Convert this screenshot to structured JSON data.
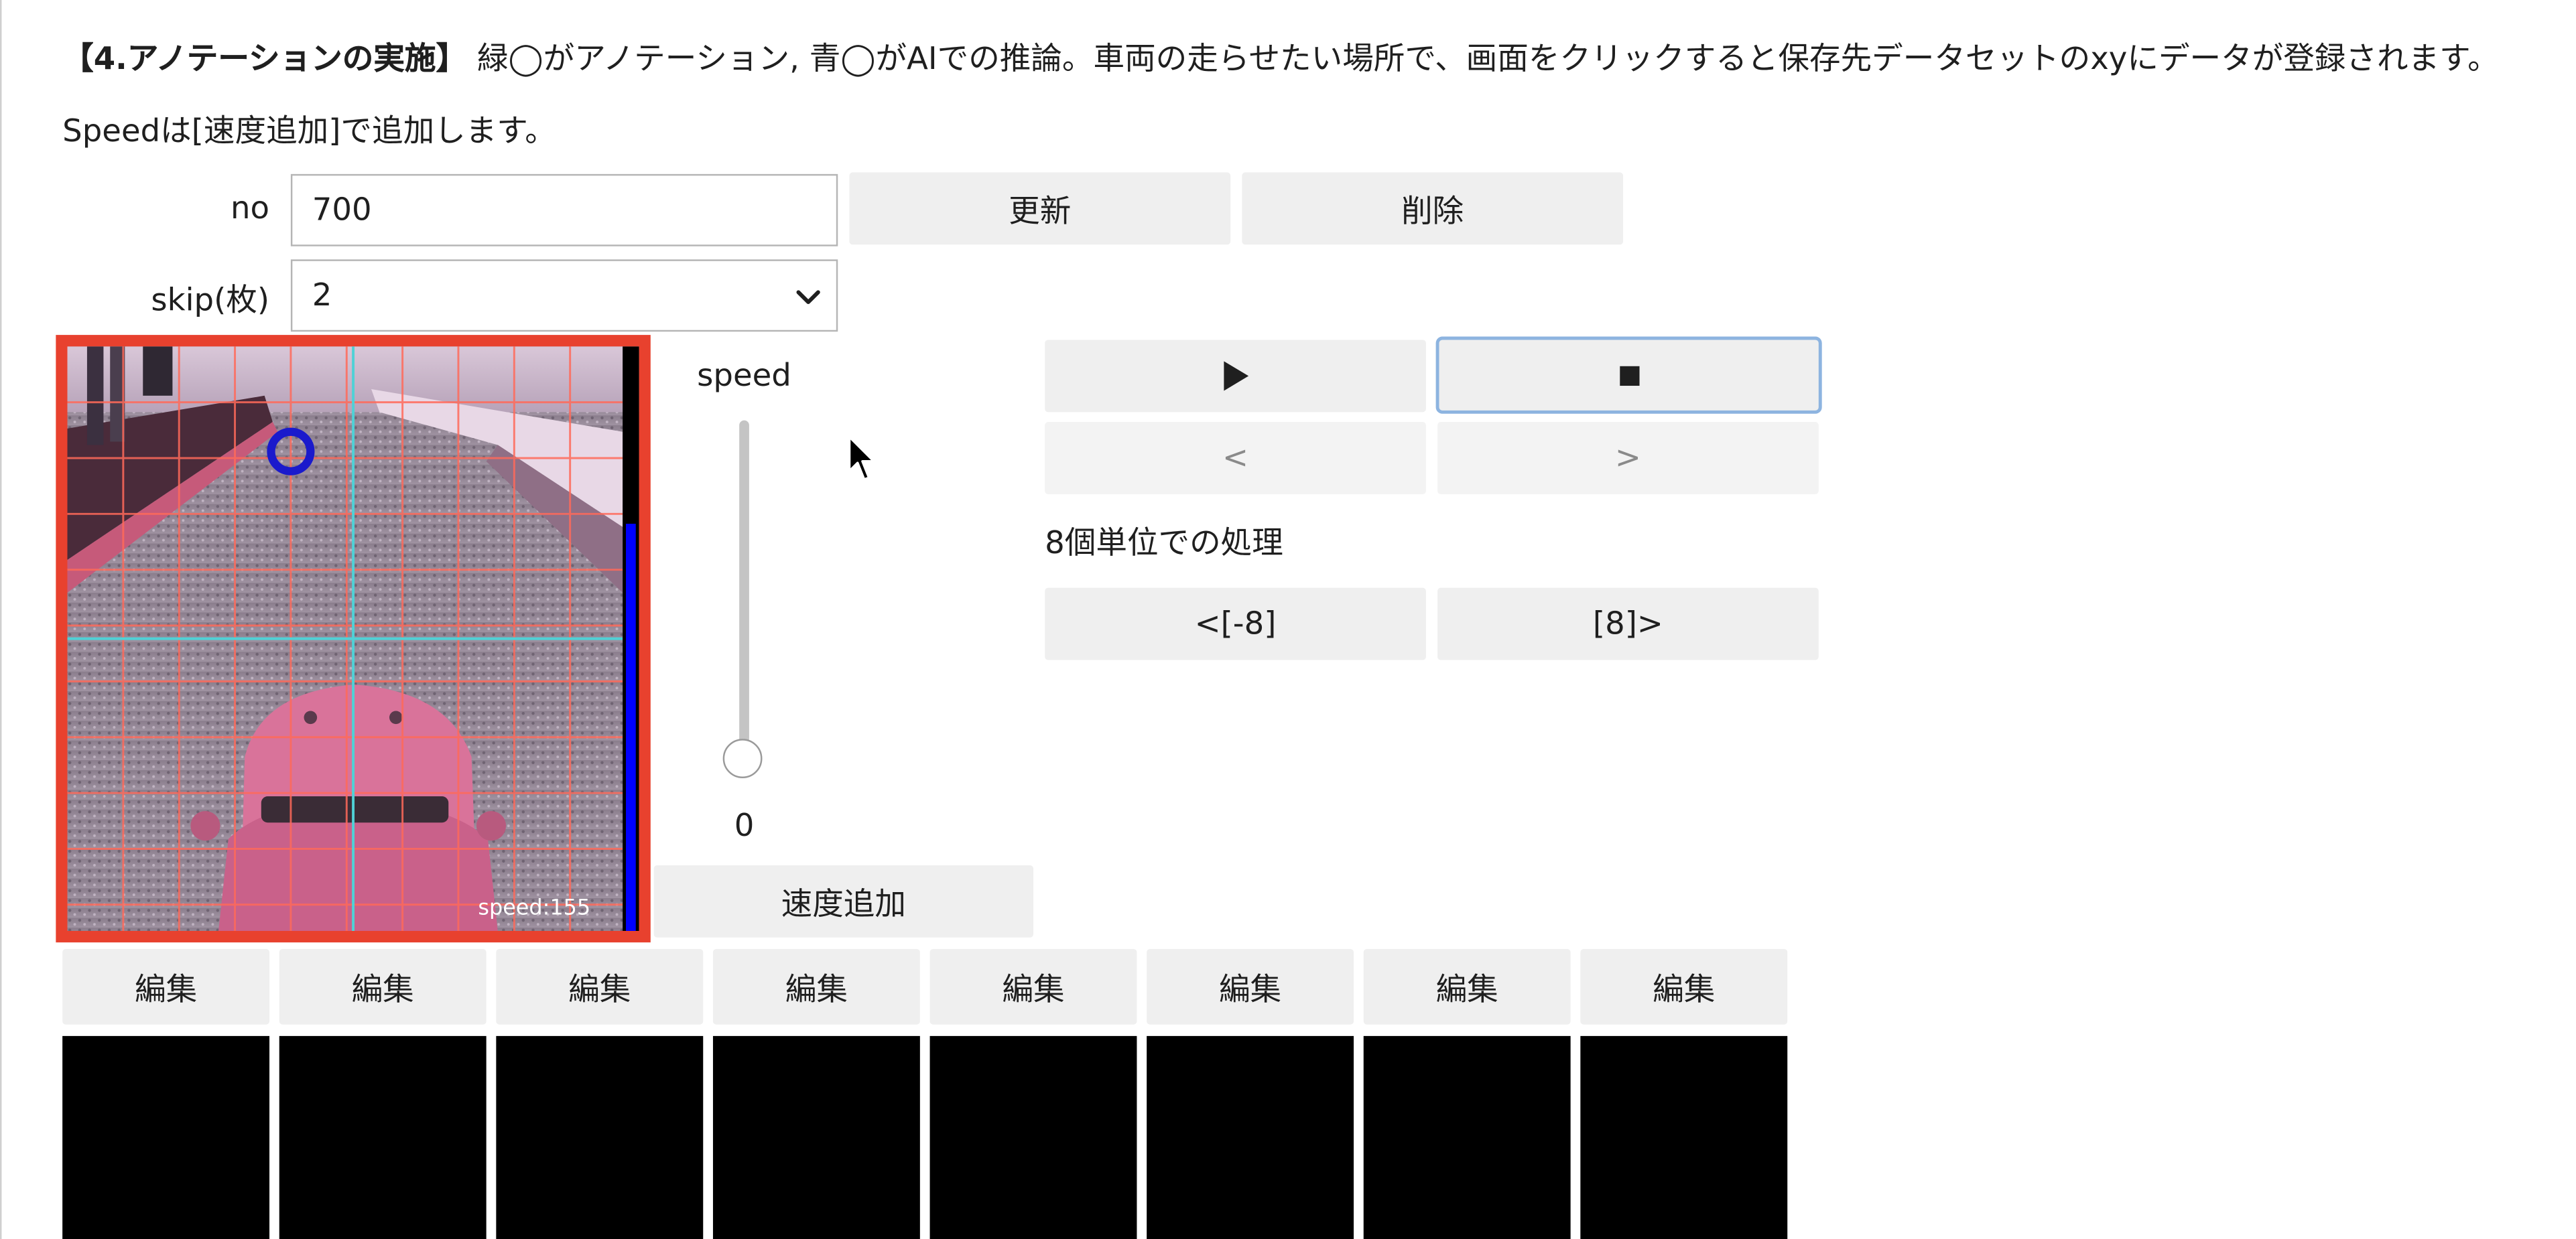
{
  "instructions": {
    "heading": "【4.アノテーションの実施】",
    "body": " 緑◯がアノテーション, 青◯がAIでの推論。車両の走らせたい場所で、画面をクリックすると保存先データセットのxyにデータが登録されます。Speedは[速度追加]で追加します。"
  },
  "form": {
    "no_label": "no",
    "no_value": "700",
    "skip_label": "skip(枚)",
    "skip_value": "2"
  },
  "buttons": {
    "update": "更新",
    "delete": "削除",
    "play": "▶",
    "stop": "■",
    "prev": "<",
    "next": ">",
    "prev8": "<[-8]",
    "next8": "[8]>",
    "add_speed": "速度追加"
  },
  "speed": {
    "label": "speed",
    "value": "0",
    "level": 0
  },
  "batch_label": "8個単位での処理",
  "camera": {
    "overlay_text": "speed:155"
  },
  "edit_buttons": [
    "編集",
    "編集",
    "編集",
    "編集",
    "編集",
    "編集",
    "編集",
    "編集"
  ],
  "colors": {
    "frame_border": "#e8412e",
    "grid": "#ff6a5a",
    "crosshair": "#4fd1d6",
    "ai_marker": "#1a1acc",
    "speed_bar": "#0000ff",
    "button_bg": "#efefef",
    "focus_ring": "#8db4e0"
  }
}
